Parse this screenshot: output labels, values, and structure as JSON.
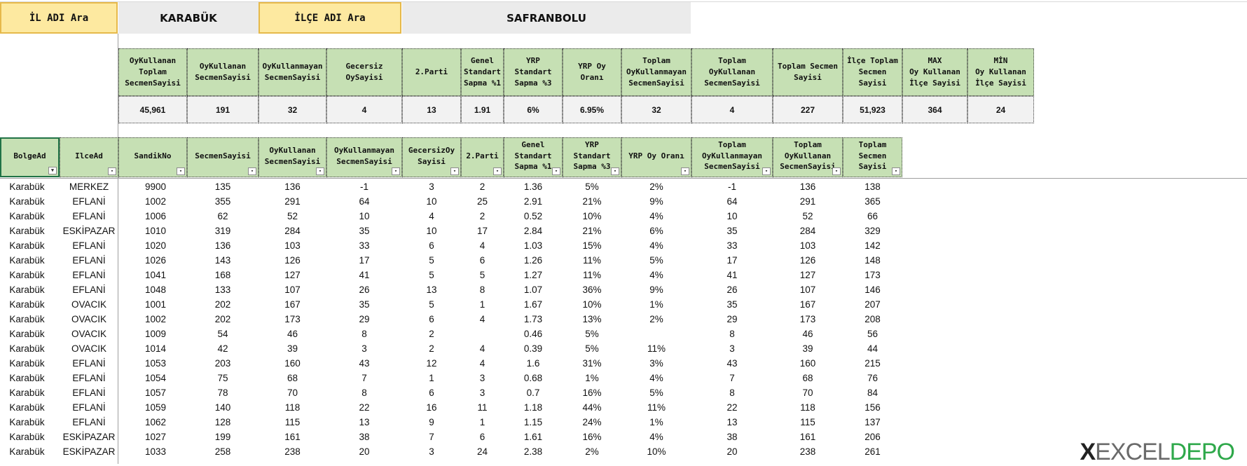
{
  "controls": {
    "il_button": "İL ADI Ara",
    "il_value": "KARABÜK",
    "ilce_button": "İLÇE ADI Ara",
    "ilce_value": "SAFRANBOLU"
  },
  "summary": {
    "headers": [
      "OyKullanan\nToplam\nSecmenSayisi",
      "OyKullanan\nSecmenSayisi",
      "OyKullanmayan\nSecmenSayisi",
      "Gecersiz\nOySayisi",
      "2.Parti",
      "Genel\nStandart\nSapma %1",
      "YRP\nStandart\nSapma %3",
      "YRP Oy\nOranı",
      "Toplam\nOyKullanmayan\nSecmenSayisi",
      "Toplam\nOyKullanan\nSecmenSayisi",
      "Toplam Secmen\nSayisi",
      "İlçe Toplam\nSecmen\nSayisi",
      "MAX\nOy Kullanan\nİlçe Sayisi",
      "MİN\nOy Kullanan\nİlçe Sayisi"
    ],
    "values": [
      "45,961",
      "191",
      "32",
      "4",
      "13",
      "1.91",
      "6%",
      "6.95%",
      "32",
      "4",
      "227",
      "51,923",
      "364",
      "24"
    ]
  },
  "table": {
    "headers": [
      "BolgeAd",
      "IlceAd",
      "SandikNo",
      "SecmenSayisi",
      "OyKullanan\nSecmenSayisi",
      "OyKullanmayan\nSecmenSayisi",
      "GecersizOy\nSayisi",
      "2.Parti",
      "Genel\nStandart\nSapma %1",
      "YRP\nStandart\nSapma %3",
      "YRP Oy Oranı",
      "Toplam\nOyKullanmayan\nSecmenSayisi",
      "Toplam\nOyKullanan\nSecmenSayisi",
      "Toplam\nSecmen\nSayisi"
    ],
    "rows": [
      [
        "Karabük",
        "MERKEZ",
        "9900",
        "135",
        "136",
        "-1",
        "3",
        "2",
        "1.36",
        "5%",
        "2%",
        "-1",
        "136",
        "138"
      ],
      [
        "Karabük",
        "EFLANİ",
        "1002",
        "355",
        "291",
        "64",
        "10",
        "25",
        "2.91",
        "21%",
        "9%",
        "64",
        "291",
        "365"
      ],
      [
        "Karabük",
        "EFLANİ",
        "1006",
        "62",
        "52",
        "10",
        "4",
        "2",
        "0.52",
        "10%",
        "4%",
        "10",
        "52",
        "66"
      ],
      [
        "Karabük",
        "ESKİPAZAR",
        "1010",
        "319",
        "284",
        "35",
        "10",
        "17",
        "2.84",
        "21%",
        "6%",
        "35",
        "284",
        "329"
      ],
      [
        "Karabük",
        "EFLANİ",
        "1020",
        "136",
        "103",
        "33",
        "6",
        "4",
        "1.03",
        "15%",
        "4%",
        "33",
        "103",
        "142"
      ],
      [
        "Karabük",
        "EFLANİ",
        "1026",
        "143",
        "126",
        "17",
        "5",
        "6",
        "1.26",
        "11%",
        "5%",
        "17",
        "126",
        "148"
      ],
      [
        "Karabük",
        "EFLANİ",
        "1041",
        "168",
        "127",
        "41",
        "5",
        "5",
        "1.27",
        "11%",
        "4%",
        "41",
        "127",
        "173"
      ],
      [
        "Karabük",
        "EFLANİ",
        "1048",
        "133",
        "107",
        "26",
        "13",
        "8",
        "1.07",
        "36%",
        "9%",
        "26",
        "107",
        "146"
      ],
      [
        "Karabük",
        "OVACIK",
        "1001",
        "202",
        "167",
        "35",
        "5",
        "1",
        "1.67",
        "10%",
        "1%",
        "35",
        "167",
        "207"
      ],
      [
        "Karabük",
        "OVACIK",
        "1002",
        "202",
        "173",
        "29",
        "6",
        "4",
        "1.73",
        "13%",
        "2%",
        "29",
        "173",
        "208"
      ],
      [
        "Karabük",
        "OVACIK",
        "1009",
        "54",
        "46",
        "8",
        "2",
        "",
        "0.46",
        "5%",
        "",
        "8",
        "46",
        "56"
      ],
      [
        "Karabük",
        "OVACIK",
        "1014",
        "42",
        "39",
        "3",
        "2",
        "4",
        "0.39",
        "5%",
        "11%",
        "3",
        "39",
        "44"
      ],
      [
        "Karabük",
        "EFLANİ",
        "1053",
        "203",
        "160",
        "43",
        "12",
        "4",
        "1.6",
        "31%",
        "3%",
        "43",
        "160",
        "215"
      ],
      [
        "Karabük",
        "EFLANİ",
        "1054",
        "75",
        "68",
        "7",
        "1",
        "3",
        "0.68",
        "1%",
        "4%",
        "7",
        "68",
        "76"
      ],
      [
        "Karabük",
        "EFLANİ",
        "1057",
        "78",
        "70",
        "8",
        "6",
        "3",
        "0.7",
        "16%",
        "5%",
        "8",
        "70",
        "84"
      ],
      [
        "Karabük",
        "EFLANİ",
        "1059",
        "140",
        "118",
        "22",
        "16",
        "11",
        "1.18",
        "44%",
        "11%",
        "22",
        "118",
        "156"
      ],
      [
        "Karabük",
        "EFLANİ",
        "1062",
        "128",
        "115",
        "13",
        "9",
        "1",
        "1.15",
        "24%",
        "1%",
        "13",
        "115",
        "137"
      ],
      [
        "Karabük",
        "ESKİPAZAR",
        "1027",
        "199",
        "161",
        "38",
        "7",
        "6",
        "1.61",
        "16%",
        "4%",
        "38",
        "161",
        "206"
      ],
      [
        "Karabük",
        "ESKİPAZAR",
        "1033",
        "258",
        "238",
        "20",
        "3",
        "24",
        "2.38",
        "2%",
        "10%",
        "20",
        "238",
        "261"
      ]
    ]
  },
  "logo": {
    "text_x": "X",
    "text_main": "EXCEL",
    "text_accent": "DEPO"
  },
  "colors": {
    "header_green": "#c6e0b4",
    "button_yellow": "#fde9a0",
    "value_gray": "#ebebeb"
  }
}
